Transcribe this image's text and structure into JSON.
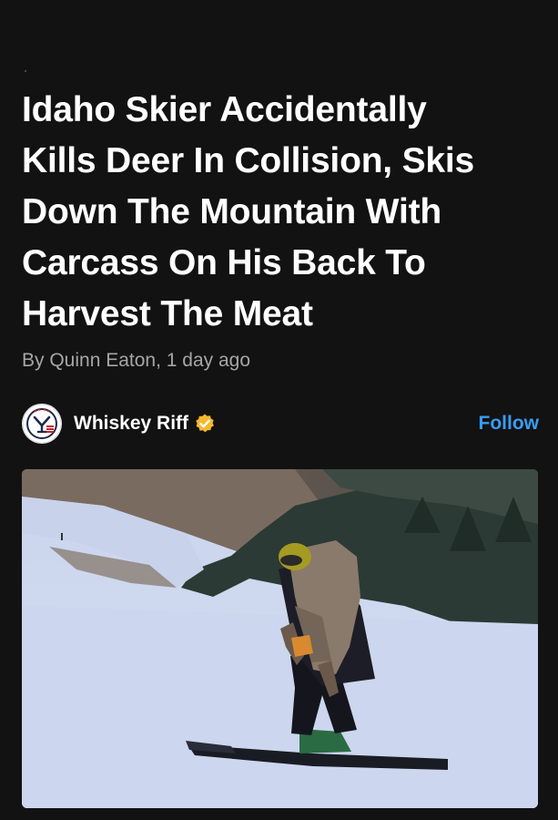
{
  "article": {
    "headline_lines": [
      "Idaho Skier Accidentally",
      "Kills Deer In Collision, Skis",
      "Down The Mountain With",
      "Carcass On His Back To",
      "Harvest The Meat"
    ],
    "byline": "By Quinn Eaton, 1 day ago"
  },
  "publisher": {
    "name": "Whiskey Riff",
    "verified": true,
    "follow_label": "Follow",
    "logo_icon": "whiskey-riff-logo",
    "badge_icon": "verified-badge-icon"
  },
  "colors": {
    "background": "#121212",
    "headline": "#ffffff",
    "byline": "#a6a6a6",
    "follow": "#3b9cf4",
    "badge": "#f5b82e"
  },
  "media": {
    "type": "photo"
  }
}
